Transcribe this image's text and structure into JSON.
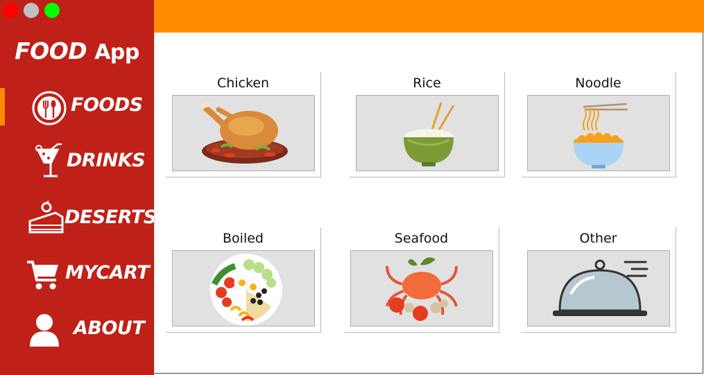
{
  "window": {
    "controls": [
      {
        "name": "close",
        "color": "#ff0000"
      },
      {
        "name": "minimize",
        "color": "#c0c0c0"
      },
      {
        "name": "maximize",
        "color": "#00ff00"
      }
    ]
  },
  "sidebar": {
    "app_title_bold": "FOOD",
    "app_title_rest": "App",
    "background": "#bf2017",
    "accent": "#ff8c00",
    "active_item": "FOODS",
    "items": [
      {
        "label": "FOODS",
        "icon": "plate-fork-spoon-icon"
      },
      {
        "label": "DRINKS",
        "icon": "cocktail-glass-icon"
      },
      {
        "label": "DESERTS",
        "icon": "cake-slice-icon"
      },
      {
        "label": "MYCART",
        "icon": "shopping-cart-icon"
      },
      {
        "label": "ABOUT",
        "icon": "user-icon"
      }
    ]
  },
  "header": {
    "color": "#ff8c00"
  },
  "categories": [
    {
      "label": "Chicken",
      "icon": "roast-chicken-icon"
    },
    {
      "label": "Rice",
      "icon": "rice-bowl-icon"
    },
    {
      "label": "Noodle",
      "icon": "noodle-bowl-icon"
    },
    {
      "label": "Boiled",
      "icon": "salad-plate-icon"
    },
    {
      "label": "Seafood",
      "icon": "crab-seafood-icon"
    },
    {
      "label": "Other",
      "icon": "food-cloche-icon"
    }
  ]
}
